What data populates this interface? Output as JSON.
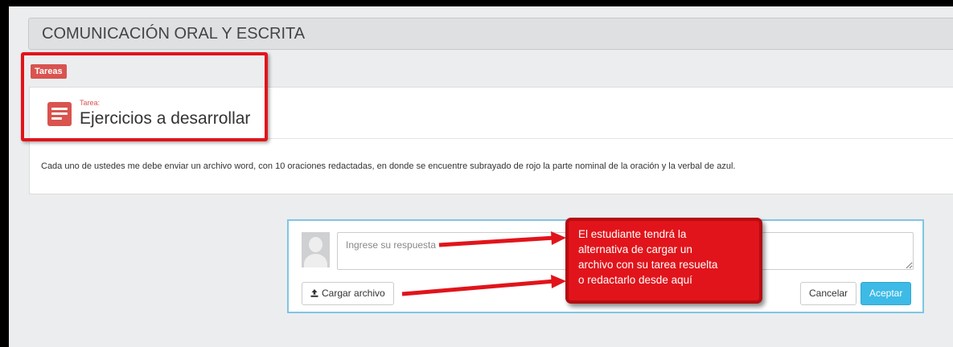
{
  "course": {
    "title": "COMUNICACIÓN ORAL Y ESCRITA"
  },
  "tab": {
    "label": "Tareas"
  },
  "task": {
    "kicker": "Tarea:",
    "title": "Ejercicios a desarrollar",
    "description": "Cada uno de ustedes me debe enviar un archivo word, con 10 oraciones redactadas, en donde se encuentre subrayado de rojo la parte nominal de la oración y la verbal de azul.",
    "icon": "task-list-icon"
  },
  "answer": {
    "placeholder": "Ingrese su respuesta",
    "value": "",
    "upload_label": "Cargar archivo",
    "upload_icon": "upload-icon",
    "cancel_label": "Cancelar",
    "accept_label": "Aceptar"
  },
  "annotation": {
    "lines": [
      "El estudiante tendrá la",
      "alternativa de cargar un",
      "archivo con su tarea resuelta",
      "o redactarlo desde aquí"
    ]
  },
  "colors": {
    "accent_red": "#d9534f",
    "annotation_red": "#e1141b",
    "accept_blue": "#3dbae6",
    "panel_border": "#7fc6e3"
  }
}
